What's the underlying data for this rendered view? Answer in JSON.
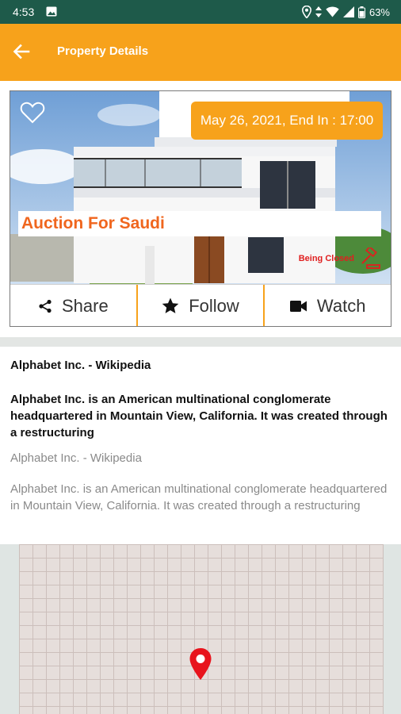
{
  "status_bar": {
    "time": "4:53",
    "battery": "63%"
  },
  "app_bar": {
    "title": "Property Details"
  },
  "property_card": {
    "date_badge": "May 26, 2021, End In : 17:00",
    "auction_title": "Auction For Saudi",
    "closing_status": "Being Closed",
    "actions": [
      {
        "label": "Share",
        "icon": "share-icon"
      },
      {
        "label": "Follow",
        "icon": "star-icon"
      },
      {
        "label": "Watch",
        "icon": "video-camera-icon"
      }
    ]
  },
  "description": {
    "title": "Alphabet Inc. - Wikipedia",
    "body": "Alphabet Inc. is an American multinational conglomerate headquartered in Mountain View, California. It was created through a restructuring",
    "title_secondary": "Alphabet Inc. - Wikipedia",
    "body_secondary": "Alphabet Inc. is an American multinational conglomerate headquartered in Mountain View, California. It was created through a restructuring"
  },
  "colors": {
    "accent": "#f7a21b",
    "status_bar": "#1e5a4a",
    "auction_title": "#f0661e",
    "alert": "#e01f1f"
  }
}
